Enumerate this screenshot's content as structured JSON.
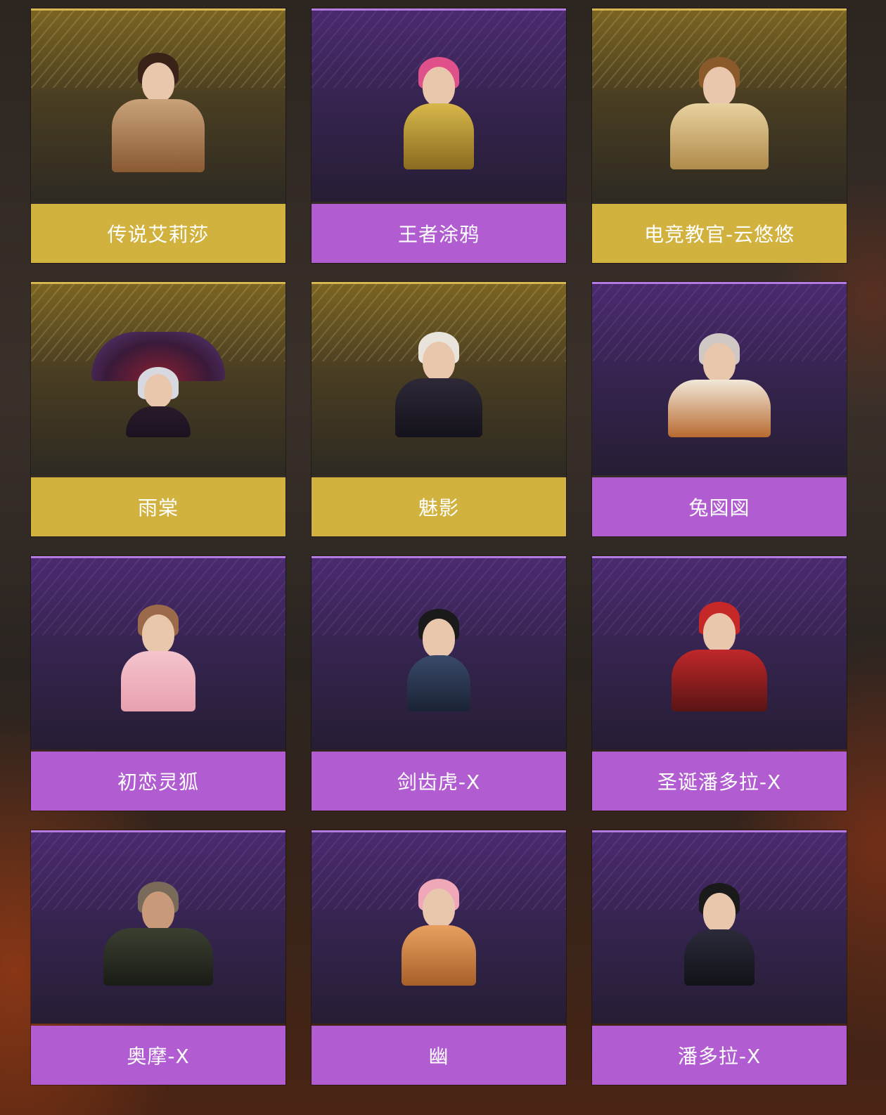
{
  "cards": [
    {
      "name": "传说艾莉莎",
      "tier": "gold",
      "icon": "character-portrait-icon"
    },
    {
      "name": "王者涂鸦",
      "tier": "purple",
      "icon": "character-portrait-icon"
    },
    {
      "name": "电竞教官-云悠悠",
      "tier": "gold",
      "icon": "character-portrait-icon"
    },
    {
      "name": "雨棠",
      "tier": "gold",
      "icon": "character-portrait-icon"
    },
    {
      "name": "魅影",
      "tier": "gold",
      "icon": "character-portrait-icon"
    },
    {
      "name": "兔図図",
      "tier": "purple",
      "icon": "character-portrait-icon"
    },
    {
      "name": "初恋灵狐",
      "tier": "purple",
      "icon": "character-portrait-icon"
    },
    {
      "name": "剑齿虎-X",
      "tier": "purple",
      "icon": "character-portrait-icon"
    },
    {
      "name": "圣诞潘多拉-X",
      "tier": "purple",
      "icon": "character-portrait-icon"
    },
    {
      "name": "奥摩-X",
      "tier": "purple",
      "icon": "character-portrait-icon"
    },
    {
      "name": "幽",
      "tier": "purple",
      "icon": "character-portrait-icon"
    },
    {
      "name": "潘多拉-X",
      "tier": "purple",
      "icon": "character-portrait-icon"
    }
  ],
  "colors": {
    "gold_label": "#d2b23e",
    "purple_label": "#b15dd1"
  }
}
